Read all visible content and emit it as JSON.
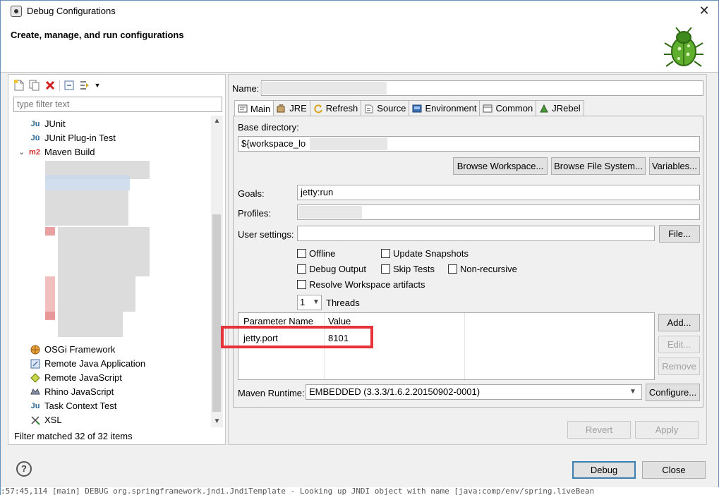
{
  "window": {
    "title": "Debug Configurations",
    "close_glyph": "✕"
  },
  "header": {
    "title": "Create, manage, and run configurations",
    "icon": "bug-icon"
  },
  "left": {
    "filter_placeholder": "type filter text",
    "tree": [
      {
        "label": "JUnit",
        "icon": "junit-icon"
      },
      {
        "label": "JUnit Plug-in Test",
        "icon": "junit-plugin-icon"
      },
      {
        "label": "Maven Build",
        "icon": "m2-icon",
        "expanded": true
      },
      {
        "label": "OSGi Framework",
        "icon": "osgi-icon"
      },
      {
        "label": "Remote Java Application",
        "icon": "remote-java-icon"
      },
      {
        "label": "Remote JavaScript",
        "icon": "remote-js-icon"
      },
      {
        "label": "Rhino JavaScript",
        "icon": "rhino-icon"
      },
      {
        "label": "Task Context Test",
        "icon": "task-context-icon"
      },
      {
        "label": "XSL",
        "icon": "xsl-icon"
      }
    ],
    "status": "Filter matched 32 of 32 items",
    "expander_glyph": "⌄"
  },
  "right": {
    "name_label": "Name:",
    "tabs": [
      {
        "label": "Main",
        "icon": "main-tab-icon",
        "active": true
      },
      {
        "label": "JRE",
        "icon": "jre-icon"
      },
      {
        "label": "Refresh",
        "icon": "refresh-icon"
      },
      {
        "label": "Source",
        "icon": "source-icon"
      },
      {
        "label": "Environment",
        "icon": "environment-icon"
      },
      {
        "label": "Common",
        "icon": "common-icon"
      },
      {
        "label": "JRebel",
        "icon": "jrebel-icon"
      }
    ],
    "base_directory_label": "Base directory:",
    "base_directory_value": "${workspace_lo",
    "browse_workspace": "Browse Workspace...",
    "browse_file_system": "Browse File System...",
    "variables": "Variables...",
    "goals_label": "Goals:",
    "goals_value": "jetty:run",
    "profiles_label": "Profiles:",
    "profiles_value": "",
    "user_settings_label": "User settings:",
    "user_settings_value": "",
    "file_button": "File...",
    "checkboxes": {
      "offline": "Offline",
      "update_snapshots": "Update Snapshots",
      "debug_output": "Debug Output",
      "skip_tests": "Skip Tests",
      "non_recursive": "Non-recursive",
      "resolve_workspace": "Resolve Workspace artifacts"
    },
    "threads_value": "1",
    "threads_label": "Threads",
    "params": {
      "headers": [
        "Parameter Name",
        "Value"
      ],
      "rows": [
        {
          "name": "jetty.port",
          "value": "8101"
        }
      ]
    },
    "add_button": "Add...",
    "edit_button": "Edit...",
    "remove_button": "Remove",
    "maven_runtime_label": "Maven Runtime:",
    "maven_runtime_value": "EMBEDDED (3.3.3/1.6.2.20150902-0001)",
    "configure_button": "Configure...",
    "revert_button": "Revert",
    "apply_button": "Apply"
  },
  "footer": {
    "debug_button": "Debug",
    "close_button": "Close",
    "help_glyph": "?",
    "log_line": ":57:45,114 [main] DEBUG org.springframework.jndi.JndiTemplate - Looking up JNDI object with name [java:comp/env/spring.liveBean"
  }
}
